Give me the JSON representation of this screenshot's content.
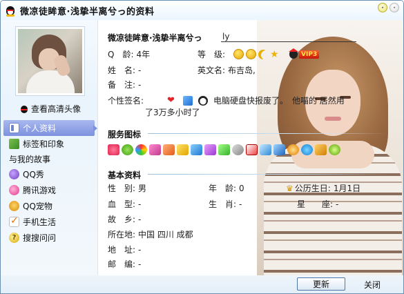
{
  "window": {
    "title": "微凉徒眸意·浅挚半离兮っ的资料",
    "colors": {
      "accent": "#7d92df",
      "border": "#6a8fb5",
      "vip": "#c8180a"
    }
  },
  "sidebar": {
    "view_hd_avatar": "查看高清头像",
    "items": [
      {
        "label": "个人资料",
        "icon": "profile-card-icon",
        "active": true
      },
      {
        "label": "标签和印象",
        "icon": "tag-icon"
      }
    ],
    "group_label": "与我的故事",
    "group_items": [
      {
        "label": "QQ秀",
        "icon": "qqshow-icon"
      },
      {
        "label": "腾讯游戏",
        "icon": "game-icon"
      },
      {
        "label": "QQ宠物",
        "icon": "pet-icon"
      },
      {
        "label": "手机生活",
        "icon": "mobile-life-icon"
      },
      {
        "label": "搜搜问问",
        "icon": "help-question-icon"
      }
    ]
  },
  "profile": {
    "name": "微凉徒眸意·浅挚半离兮っ",
    "signature_field": "ly",
    "q_age": {
      "label": "Q　龄:",
      "value": "4年"
    },
    "level": {
      "label": "等　级:",
      "vip": "VIP3"
    },
    "surname": {
      "label": "姓　名:",
      "value": "-"
    },
    "english_name": {
      "label": "英文名:",
      "value": "布吉岛,"
    },
    "remark": {
      "label": "备　注:",
      "value": "-"
    },
    "signature": {
      "label": "个性签名:",
      "text_line1": "电脑硬盘快报废了。　他喵的 居然用",
      "text_line2": "了3万多小时了"
    }
  },
  "services": {
    "title": "服务图标",
    "count": 18
  },
  "basic": {
    "title": "基本资料",
    "gender": {
      "label": "性　别:",
      "value": "男"
    },
    "age": {
      "label": "年　龄:",
      "value": "0"
    },
    "birthday": {
      "label": "公历生日:",
      "value": "1月1日"
    },
    "blood": {
      "label": "血　型:",
      "value": "-"
    },
    "zodiac": {
      "label": "生　肖:",
      "value": "-"
    },
    "constellation": {
      "label": "星　　座:",
      "value": "-"
    },
    "hometown": {
      "label": "故　乡:",
      "value": "-"
    },
    "location": {
      "label": "所在地:",
      "value": "中国 四川 成都"
    },
    "address": {
      "label": "地　址:",
      "value": "-"
    },
    "postcode": {
      "label": "邮　编:",
      "value": "-"
    }
  },
  "footer": {
    "refresh": "更新",
    "close": "关闭"
  }
}
